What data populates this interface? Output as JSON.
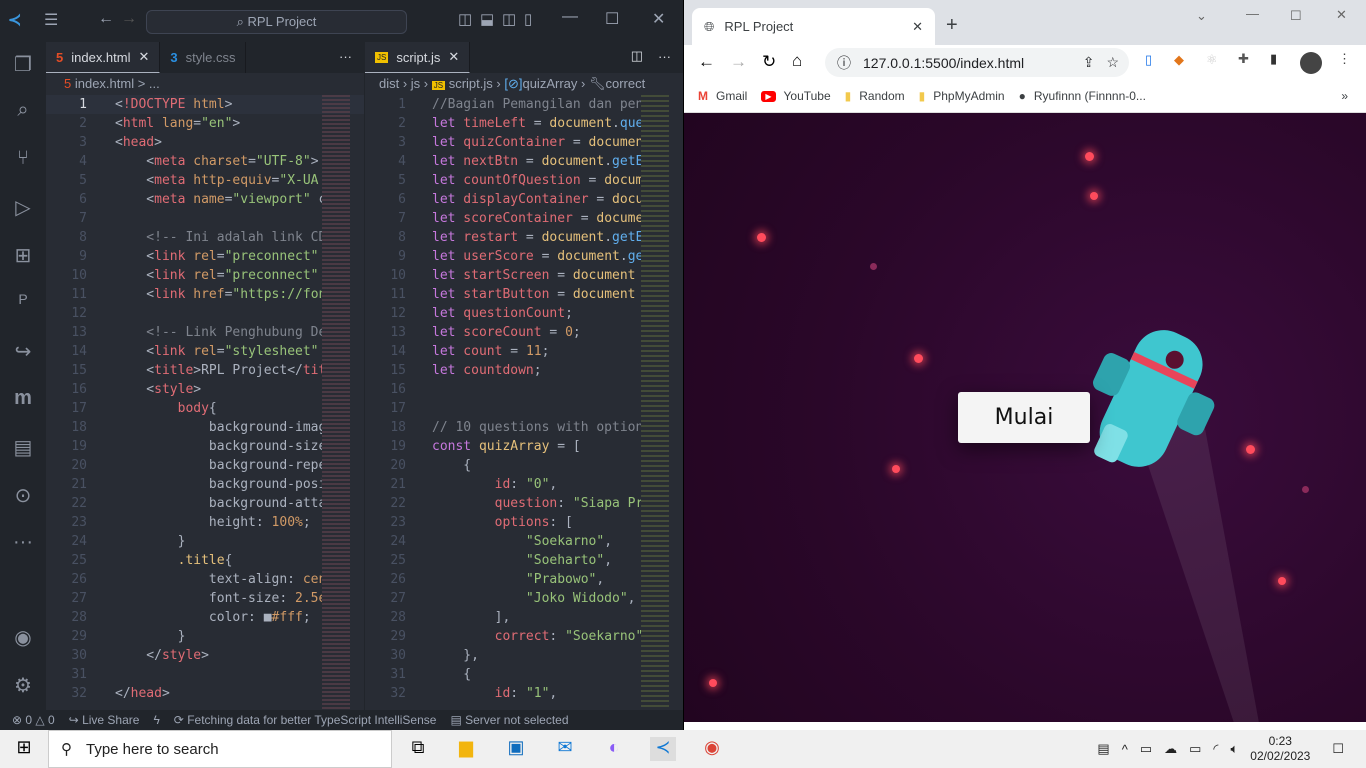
{
  "vscode": {
    "search_label": "RPL Project",
    "left_tabs": [
      {
        "label": "index.html",
        "icon": "html5-icon"
      },
      {
        "label": "style.css",
        "icon": "css3-icon"
      }
    ],
    "right_tab": {
      "label": "script.js"
    },
    "more": "···",
    "left_breadcrumb": "index.html > ...",
    "right_breadcrumb": [
      "dist",
      "js",
      "script.js",
      "quizArray",
      "correct"
    ],
    "left_code": [
      [
        [
          "p",
          "<"
        ],
        [
          "t",
          "!DOCTYPE"
        ],
        [
          "a",
          " html"
        ],
        [
          "p",
          ">"
        ]
      ],
      [
        [
          "p",
          "<"
        ],
        [
          "t",
          "html"
        ],
        [
          "a",
          " lang"
        ],
        [
          "p",
          "="
        ],
        [
          "s",
          "\"en\""
        ],
        [
          "p",
          ">"
        ]
      ],
      [
        [
          "p",
          "<"
        ],
        [
          "t",
          "head"
        ],
        [
          "p",
          ">"
        ]
      ],
      [
        [
          "p",
          "    <"
        ],
        [
          "t",
          "meta"
        ],
        [
          "a",
          " charset"
        ],
        [
          "p",
          "="
        ],
        [
          "s",
          "\"UTF-8\""
        ],
        [
          "p",
          ">"
        ]
      ],
      [
        [
          "p",
          "    <"
        ],
        [
          "t",
          "meta"
        ],
        [
          "a",
          " http-equiv"
        ],
        [
          "p",
          "="
        ],
        [
          "s",
          "\"X-UA"
        ]
      ],
      [
        [
          "p",
          "    <"
        ],
        [
          "t",
          "meta"
        ],
        [
          "a",
          " name"
        ],
        [
          "p",
          "="
        ],
        [
          "s",
          "\"viewport\""
        ],
        [
          "p",
          " c"
        ]
      ],
      [],
      [
        [
          "c",
          "    <!-- Ini adalah link CD"
        ]
      ],
      [
        [
          "p",
          "    <"
        ],
        [
          "t",
          "link"
        ],
        [
          "a",
          " rel"
        ],
        [
          "p",
          "="
        ],
        [
          "s",
          "\"preconnect\""
        ]
      ],
      [
        [
          "p",
          "    <"
        ],
        [
          "t",
          "link"
        ],
        [
          "a",
          " rel"
        ],
        [
          "p",
          "="
        ],
        [
          "s",
          "\"preconnect\""
        ]
      ],
      [
        [
          "p",
          "    <"
        ],
        [
          "t",
          "link"
        ],
        [
          "a",
          " href"
        ],
        [
          "p",
          "="
        ],
        [
          "s",
          "\"https://fon"
        ]
      ],
      [],
      [
        [
          "c",
          "    <!-- Link Penghubung De"
        ]
      ],
      [
        [
          "p",
          "    <"
        ],
        [
          "t",
          "link"
        ],
        [
          "a",
          " rel"
        ],
        [
          "p",
          "="
        ],
        [
          "s",
          "\"stylesheet\""
        ]
      ],
      [
        [
          "p",
          "    <"
        ],
        [
          "t",
          "title"
        ],
        [
          "p",
          ">RPL Project</"
        ],
        [
          "t",
          "tit"
        ]
      ],
      [
        [
          "p",
          "    <"
        ],
        [
          "t",
          "style"
        ],
        [
          "p",
          ">"
        ]
      ],
      [
        [
          "t",
          "        body"
        ],
        [
          "p",
          "{"
        ]
      ],
      [
        [
          "w",
          "            background-imag"
        ]
      ],
      [
        [
          "w",
          "            background-size"
        ]
      ],
      [
        [
          "w",
          "            background-repe"
        ]
      ],
      [
        [
          "w",
          "            background-posi"
        ]
      ],
      [
        [
          "w",
          "            background-atta"
        ]
      ],
      [
        [
          "w",
          "            height: "
        ],
        [
          "n",
          "100%"
        ],
        [
          "p",
          ";"
        ]
      ],
      [
        [
          "p",
          "        }"
        ]
      ],
      [
        [
          "y",
          "        .title"
        ],
        [
          "p",
          "{"
        ]
      ],
      [
        [
          "w",
          "            text-align: "
        ],
        [
          "n",
          "cen"
        ]
      ],
      [
        [
          "w",
          "            font-size: "
        ],
        [
          "n",
          "2.5e"
        ]
      ],
      [
        [
          "w",
          "            color: "
        ],
        [
          "p",
          "■"
        ],
        [
          "n",
          "#fff"
        ],
        [
          "p",
          ";"
        ]
      ],
      [
        [
          "p",
          "        }"
        ]
      ],
      [
        [
          "p",
          "    </"
        ],
        [
          "t",
          "style"
        ],
        [
          "p",
          ">"
        ]
      ],
      [],
      [
        [
          "p",
          "</"
        ],
        [
          "t",
          "head"
        ],
        [
          "p",
          ">"
        ]
      ]
    ],
    "right_code": [
      [
        [
          "c",
          "//Bagian Pemangilan dan pen"
        ]
      ],
      [
        [
          "k",
          "let"
        ],
        [
          "t",
          " timeLeft"
        ],
        [
          "p",
          " = "
        ],
        [
          "y",
          "document"
        ],
        [
          "p",
          "."
        ],
        [
          "f",
          "que"
        ]
      ],
      [
        [
          "k",
          "let"
        ],
        [
          "t",
          " quizContainer"
        ],
        [
          "p",
          " = "
        ],
        [
          "y",
          "documen"
        ]
      ],
      [
        [
          "k",
          "let"
        ],
        [
          "t",
          " nextBtn"
        ],
        [
          "p",
          " = "
        ],
        [
          "y",
          "document"
        ],
        [
          "p",
          "."
        ],
        [
          "f",
          "getE"
        ]
      ],
      [
        [
          "k",
          "let"
        ],
        [
          "t",
          " countOfQuestion"
        ],
        [
          "p",
          " = "
        ],
        [
          "y",
          "docum"
        ]
      ],
      [
        [
          "k",
          "let"
        ],
        [
          "t",
          " displayContainer"
        ],
        [
          "p",
          " = "
        ],
        [
          "y",
          "docu"
        ]
      ],
      [
        [
          "k",
          "let"
        ],
        [
          "t",
          " scoreContainer"
        ],
        [
          "p",
          " = "
        ],
        [
          "y",
          "docume"
        ]
      ],
      [
        [
          "k",
          "let"
        ],
        [
          "t",
          " restart"
        ],
        [
          "p",
          " = "
        ],
        [
          "y",
          "document"
        ],
        [
          "p",
          "."
        ],
        [
          "f",
          "getE"
        ]
      ],
      [
        [
          "k",
          "let"
        ],
        [
          "t",
          " userScore"
        ],
        [
          "p",
          " = "
        ],
        [
          "y",
          "document"
        ],
        [
          "p",
          "."
        ],
        [
          "f",
          "ge"
        ]
      ],
      [
        [
          "k",
          "let"
        ],
        [
          "t",
          " startScreen"
        ],
        [
          "p",
          " = "
        ],
        [
          "y",
          "document"
        ]
      ],
      [
        [
          "k",
          "let"
        ],
        [
          "t",
          " startButton"
        ],
        [
          "p",
          " = "
        ],
        [
          "y",
          "document"
        ]
      ],
      [
        [
          "k",
          "let"
        ],
        [
          "t",
          " questionCount"
        ],
        [
          "p",
          ";"
        ]
      ],
      [
        [
          "k",
          "let"
        ],
        [
          "t",
          " scoreCount"
        ],
        [
          "p",
          " = "
        ],
        [
          "n",
          "0"
        ],
        [
          "p",
          ";"
        ]
      ],
      [
        [
          "k",
          "let"
        ],
        [
          "t",
          " count"
        ],
        [
          "p",
          " = "
        ],
        [
          "n",
          "11"
        ],
        [
          "p",
          ";"
        ]
      ],
      [
        [
          "k",
          "let"
        ],
        [
          "t",
          " countdown"
        ],
        [
          "p",
          ";"
        ]
      ],
      [],
      [],
      [
        [
          "c",
          "// 10 questions with option"
        ]
      ],
      [
        [
          "k",
          "const"
        ],
        [
          "y",
          " quizArray"
        ],
        [
          "p",
          " = ["
        ]
      ],
      [
        [
          "p",
          "    {"
        ]
      ],
      [
        [
          "t",
          "        id"
        ],
        [
          "p",
          ": "
        ],
        [
          "s",
          "\"0\""
        ],
        [
          "p",
          ","
        ]
      ],
      [
        [
          "t",
          "        question"
        ],
        [
          "p",
          ": "
        ],
        [
          "s",
          "\"Siapa Pr"
        ]
      ],
      [
        [
          "t",
          "        options"
        ],
        [
          "p",
          ": ["
        ]
      ],
      [
        [
          "s",
          "            \"Soekarno\""
        ],
        [
          "p",
          ","
        ]
      ],
      [
        [
          "s",
          "            \"Soeharto\""
        ],
        [
          "p",
          ","
        ]
      ],
      [
        [
          "s",
          "            \"Prabowo\""
        ],
        [
          "p",
          ","
        ]
      ],
      [
        [
          "s",
          "            \"Joko Widodo\""
        ],
        [
          "p",
          ","
        ]
      ],
      [
        [
          "p",
          "        ],"
        ]
      ],
      [
        [
          "t",
          "        correct"
        ],
        [
          "p",
          ": "
        ],
        [
          "s",
          "\"Soekarno\""
        ]
      ],
      [
        [
          "p",
          "    },"
        ]
      ],
      [
        [
          "p",
          "    {"
        ]
      ],
      [
        [
          "t",
          "        id"
        ],
        [
          "p",
          ": "
        ],
        [
          "s",
          "\"1\""
        ],
        [
          "p",
          ","
        ]
      ]
    ],
    "status": {
      "errors": "0",
      "warnings": "0",
      "live_share": "Live Share",
      "fetching": "Fetching data for better TypeScript IntelliSense",
      "server": "Server not selected"
    }
  },
  "browser": {
    "tab_title": "RPL Project",
    "url": "127.0.0.1:5500/index.html",
    "bookmarks": [
      {
        "label": "Gmail",
        "icon": "gmail-icon"
      },
      {
        "label": "YouTube",
        "icon": "youtube-icon"
      },
      {
        "label": "Random",
        "icon": "folder-icon"
      },
      {
        "label": "PhpMyAdmin",
        "icon": "folder-icon"
      },
      {
        "label": "Ryufinnn (Finnnn-0...",
        "icon": "github-icon"
      }
    ],
    "start_button": "Mulai"
  },
  "taskbar": {
    "search_placeholder": "Type here to search",
    "time": "0:23",
    "date": "02/02/2023"
  }
}
